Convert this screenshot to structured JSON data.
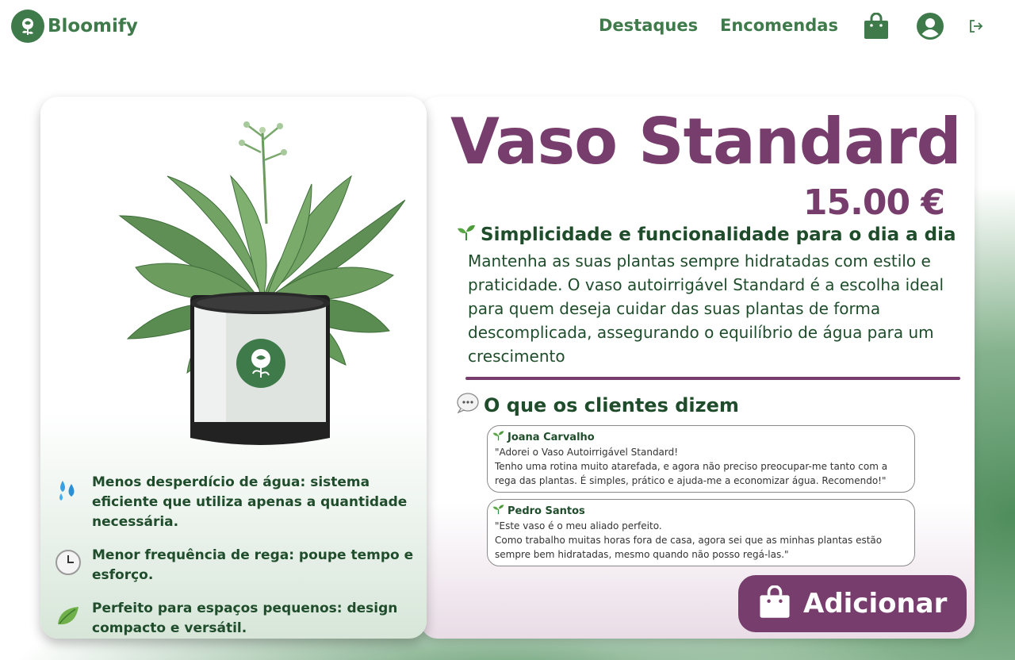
{
  "app": {
    "name": "Bloomify"
  },
  "nav": {
    "destaques": "Destaques",
    "encomendas": "Encomendas",
    "icons": [
      "shopping-bag-icon",
      "user-account-icon",
      "logout-icon"
    ]
  },
  "product": {
    "title": "Vaso Standard",
    "price": "15.00 €",
    "subtitle": "Simplicidade e funcionalidade para o dia a dia",
    "description": "Mantenha as suas plantas sempre hidratadas com estilo e praticidade.  O vaso autoirrigável Standard é a escolha ideal para quem deseja cuidar  das suas plantas de forma descomplicada, assegurando o equilíbrio de água para um crescimento"
  },
  "features": [
    {
      "icon": "water-drops-icon",
      "text": "Menos desperdício de água: sistema eficiente que  utiliza apenas a quantidade necessária."
    },
    {
      "icon": "clock-icon",
      "text": "Menor frequência de rega: poupe tempo e esforço."
    },
    {
      "icon": "leaf-icon",
      "text": "Perfeito para espaços pequenos: design compacto e versátil."
    }
  ],
  "reviews": {
    "heading": "O que os clientes dizem",
    "items": [
      {
        "name": "Joana Carvalho",
        "text": "\"Adorei o Vaso Autoirrigável Standard!\nTenho uma rotina muito atarefada, e agora não preciso preocupar-me tanto com a rega das plantas. É simples, prático e ajuda-me a economizar água. Recomendo!\""
      },
      {
        "name": "Pedro Santos",
        "text": "\"Este vaso é o meu aliado perfeito.\nComo trabalho muitas horas fora de casa, agora sei que as minhas plantas estão sempre bem hidratadas, mesmo quando não posso regá-las.\""
      }
    ]
  },
  "actions": {
    "add_label": "Adicionar"
  },
  "colors": {
    "brand_green": "#3f7a4b",
    "text_green": "#1f4d2b",
    "accent_purple": "#773d6c"
  }
}
